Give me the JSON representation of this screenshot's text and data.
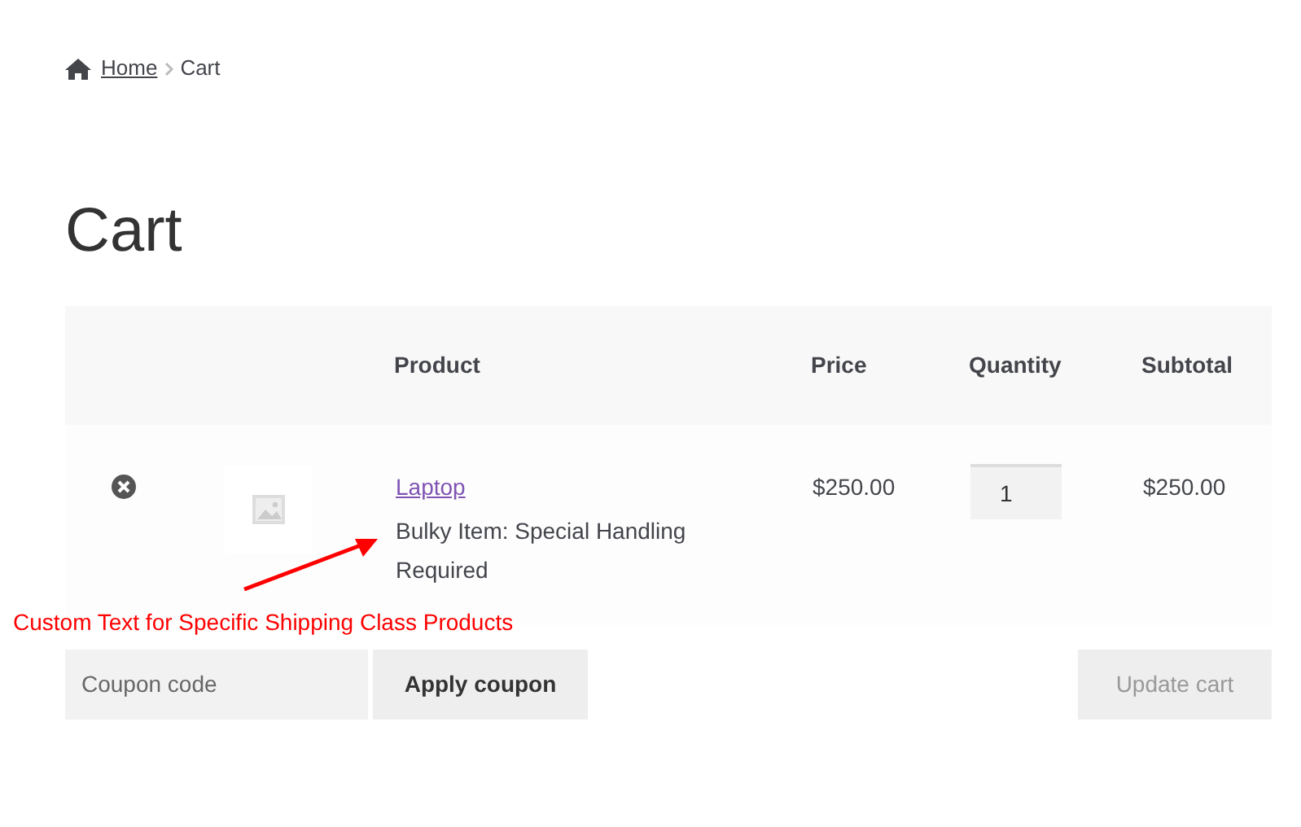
{
  "breadcrumb": [
    {
      "label": "Home",
      "link": true
    },
    {
      "label": "Cart",
      "link": false
    }
  ],
  "title": "Cart",
  "table": {
    "columns": [
      {
        "label": "Product"
      },
      {
        "label": "Price"
      },
      {
        "label": "Quantity"
      },
      {
        "label": "Subtotal"
      }
    ],
    "rows": [
      {
        "product": "Laptop",
        "note": "Bulky Item: Special Handling Required",
        "price": "$250.00",
        "quantity": "1",
        "subtotal": "$250.00"
      }
    ]
  },
  "annotation": {
    "text": "Custom Text for Specific Shipping Class Products"
  },
  "coupon": {
    "placeholder": "Coupon code",
    "apply": "Apply coupon",
    "update": "Update cart",
    "update_disabled": true
  }
}
